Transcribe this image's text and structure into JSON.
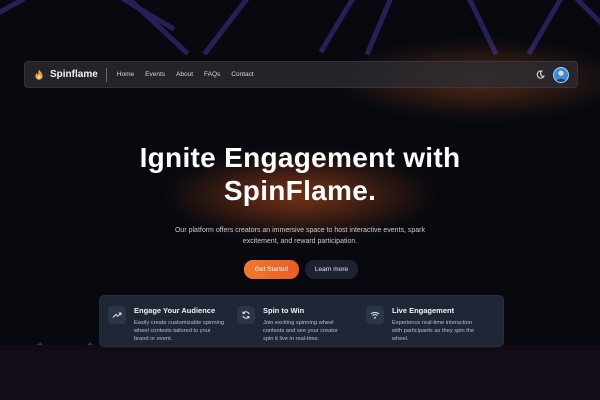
{
  "navbar": {
    "brand": "Spinflame",
    "links": [
      "Home",
      "Events",
      "About",
      "FAQs",
      "Contact"
    ]
  },
  "icons": {
    "logo": "flame-icon",
    "theme_toggle": "moon-icon",
    "avatar": "user-avatar",
    "feature_icons": [
      "trending-up-icon",
      "refresh-icon",
      "wifi-icon"
    ]
  },
  "colors": {
    "background": "#07090f",
    "accent": "#f0692a",
    "panel": "#1f2736",
    "decor_lines": "#3b2a7a"
  },
  "hero": {
    "title_line1": "Ignite Engagement with",
    "title_line2": "SpinFlame.",
    "subtitle_line1": "Our platform offers creators an immersive space to host interactive events, spark",
    "subtitle_line2": "excitement, and reward participation.",
    "primary_cta": "Get Started",
    "secondary_cta": "Learn more"
  },
  "features": [
    {
      "title": "Engage Your Audience",
      "desc_lines": [
        "Easily create customizable spinning",
        "wheel contests tailored to your",
        "brand or event."
      ]
    },
    {
      "title": "Spin to Win",
      "desc_lines": [
        "Join exciting spinning wheel",
        "contests and see your creator",
        "spin it live in real-time."
      ]
    },
    {
      "title": "Live Engagement",
      "desc_lines": [
        "Experience real-time interaction",
        "with participants as they spin the",
        "wheel."
      ]
    }
  ]
}
